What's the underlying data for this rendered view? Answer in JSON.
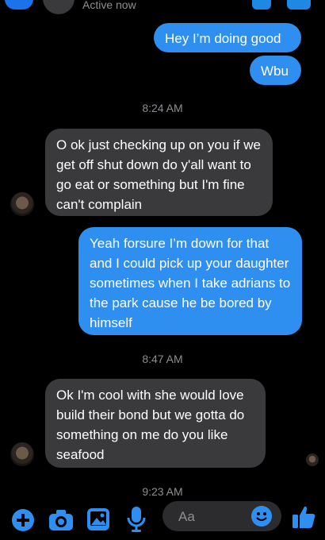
{
  "header": {
    "status": "Active now"
  },
  "messages": [
    {
      "side": "out",
      "text": "Hey I’m doing good"
    },
    {
      "side": "out",
      "text": "Wbu"
    },
    {
      "side": "in",
      "text": "O ok just checking up on you if we get off shut down do y'all want to go eat or something but I'm fine can't complain"
    },
    {
      "side": "out",
      "text": "Yeah forsure I’m down for that and I could pick up your daughter sometimes when I take adrians to the park cause he be bored by himself"
    },
    {
      "side": "in",
      "text": "Ok I'm cool with she would love build their bond but we gotta do something on me do you like seafood"
    }
  ],
  "timestamps": [
    "8:24 AM",
    "8:47 AM",
    "9:23 AM"
  ],
  "composer": {
    "placeholder": "Aa"
  },
  "colors": {
    "outgoing": "#2e8ff0",
    "incoming": "#3a3a3c",
    "background": "#000000",
    "accent": "#1e88e5"
  }
}
